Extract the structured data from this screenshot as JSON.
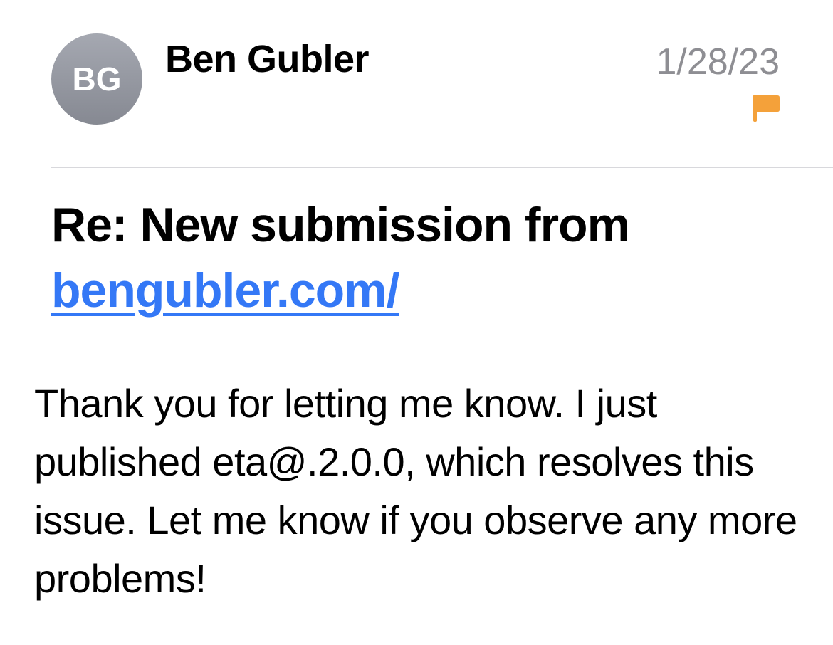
{
  "message": {
    "sender": {
      "initials": "BG",
      "name": "Ben Gubler"
    },
    "date": "1/28/23",
    "flag": {
      "icon": "flag-icon",
      "color": "#f4a13a"
    },
    "subject": {
      "prefix": "Re: New submission from ",
      "link_text": "bengubler.com/"
    },
    "body": "Thank you for letting me know. I just published eta@.2.0.0, which resolves this issue. Let me know if you observe any more problems!"
  },
  "colors": {
    "link": "#3478f6",
    "date": "#8e8e93",
    "avatar": "#9a9da6"
  }
}
